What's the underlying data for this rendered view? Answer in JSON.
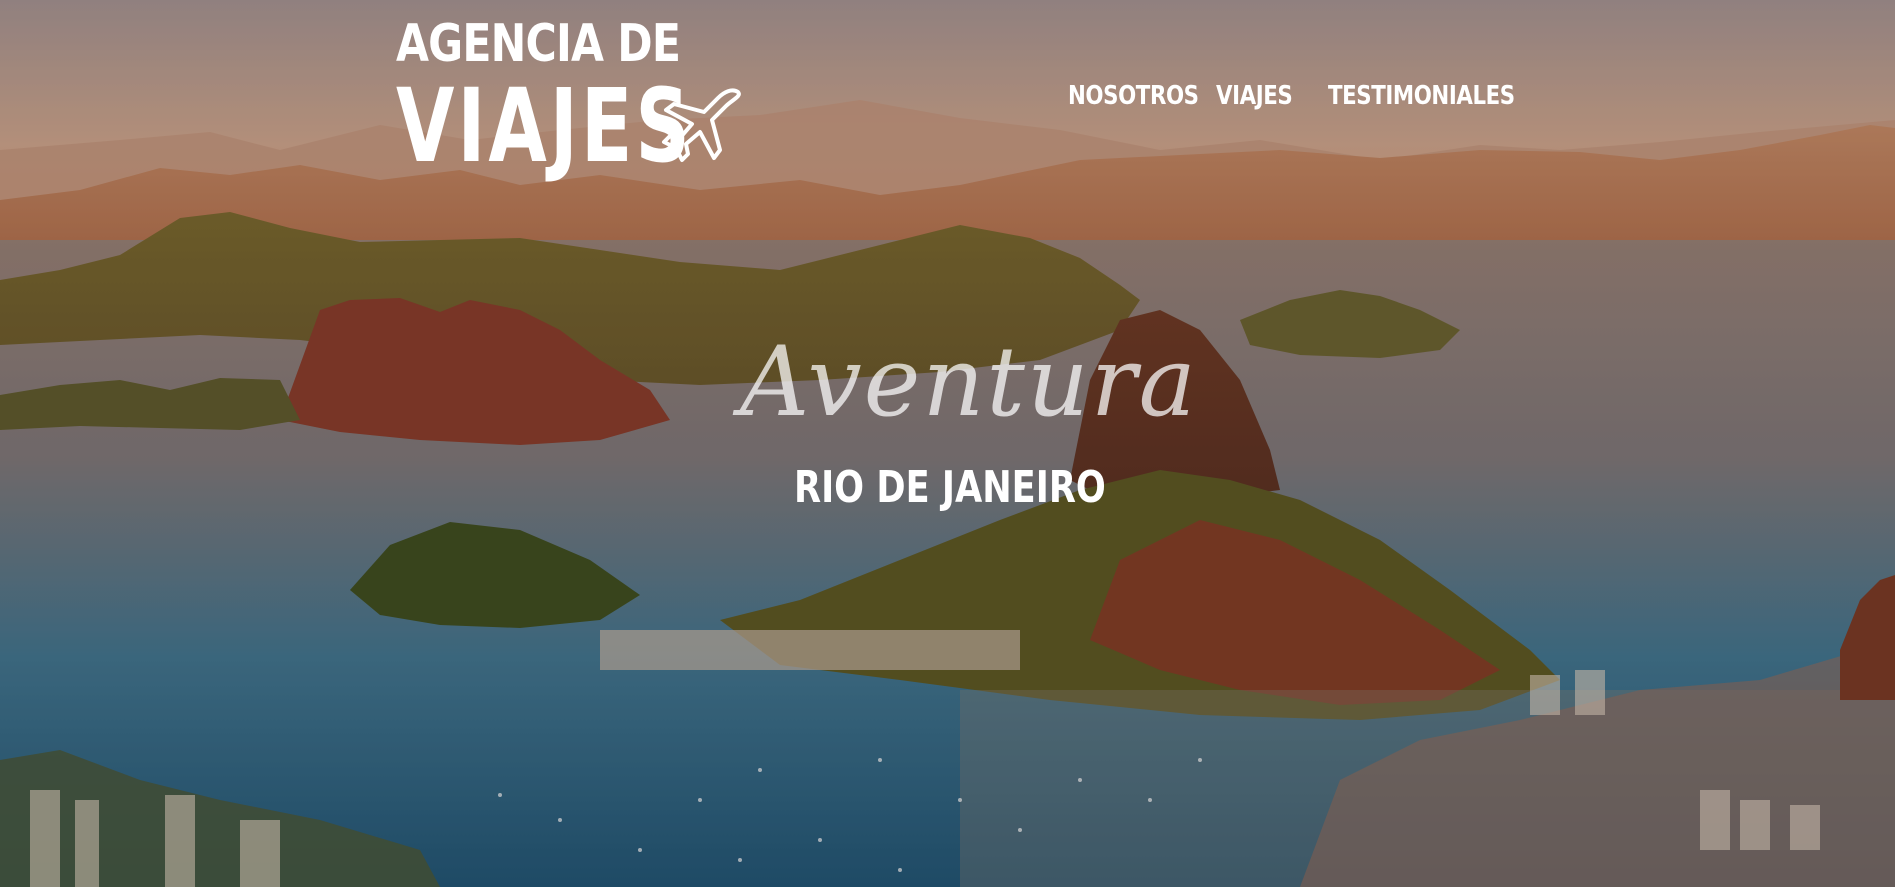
{
  "logo": {
    "line1": "AGENCIA DE",
    "line2": "VIAJES",
    "icon": "airplane-icon"
  },
  "nav": {
    "items": [
      {
        "label": "NOSOTROS"
      },
      {
        "label": "VIAJES"
      },
      {
        "label": "TESTIMONIALES"
      }
    ]
  },
  "hero": {
    "script_title": "Aventura",
    "subtitle": "RIO DE JANEIRO"
  },
  "colors": {
    "text": "#ffffff",
    "sky": "#b59a92",
    "water": "#1f5c7a",
    "mountain": "#7a4a2c"
  }
}
